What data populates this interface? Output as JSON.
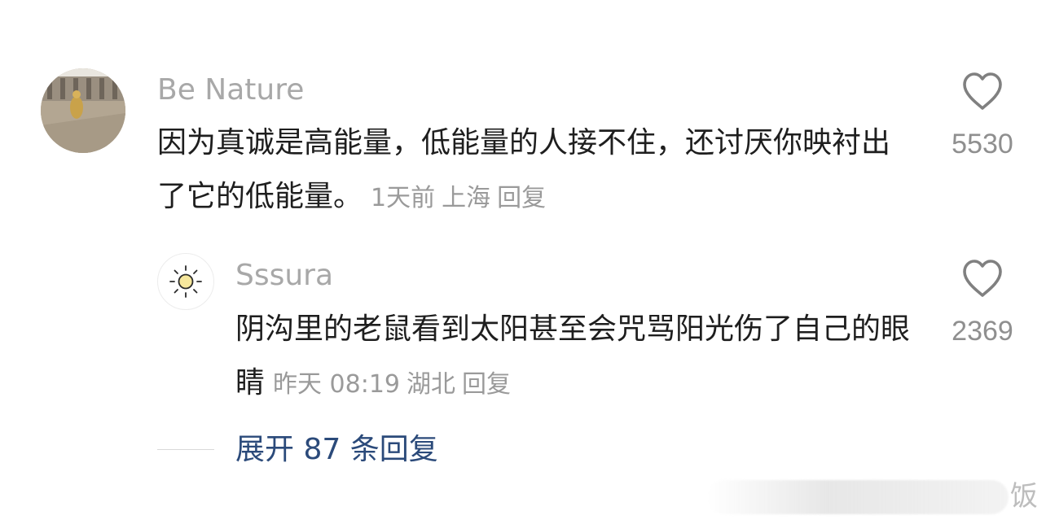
{
  "comment": {
    "username": "Be Nature",
    "text": "因为真诚是高能量，低能量的人接不住，还讨厌你映衬出了它的低能量。",
    "time": "1天前",
    "location": "上海",
    "reply_label": "回复",
    "like_count": "5530",
    "avatar": "photo-avatar",
    "like_icon": "heart-outline-icon"
  },
  "reply": {
    "username": "Sssura",
    "text": "阴沟里的老鼠看到太阳甚至会咒骂阳光伤了自己的眼睛",
    "time": "昨天 08:19",
    "location": "湖北",
    "reply_label": "回复",
    "like_count": "2369",
    "avatar": "sun-icon",
    "like_icon": "heart-outline-icon"
  },
  "expand": {
    "label": "展开 87 条回复"
  },
  "watermark": {
    "char": "饭"
  },
  "colors": {
    "username": "#a8a8a8",
    "text": "#1e1e1e",
    "meta": "#9a9a9a",
    "expand_link": "#2b4a7a",
    "like_count": "#8f8f8f"
  }
}
